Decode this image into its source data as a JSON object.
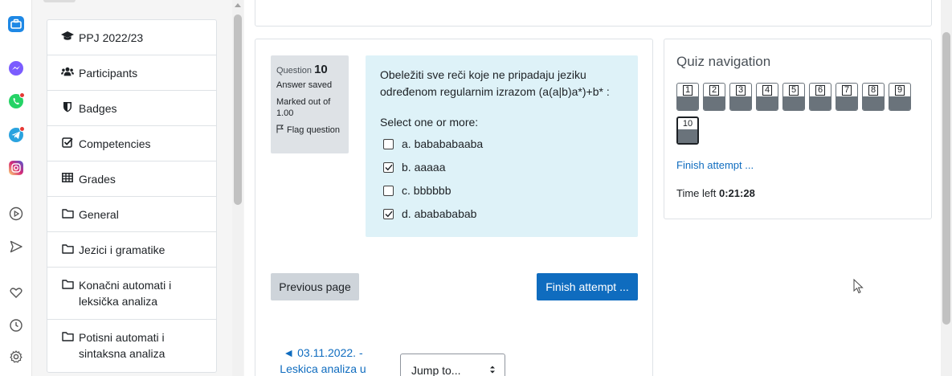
{
  "browser_sidebar": {
    "icons": [
      "briefcase-icon",
      "messenger-icon",
      "whatsapp-icon",
      "telegram-icon",
      "instagram-icon",
      "play-circle-icon",
      "send-icon",
      "heart-icon",
      "clock-icon",
      "settings-icon"
    ]
  },
  "course_index": {
    "items": [
      {
        "label": "PPJ 2022/23",
        "icon": "graduation-cap-icon"
      },
      {
        "label": "Participants",
        "icon": "users-icon"
      },
      {
        "label": "Badges",
        "icon": "shield-icon"
      },
      {
        "label": "Competencies",
        "icon": "checkbox-icon"
      },
      {
        "label": "Grades",
        "icon": "table-icon"
      },
      {
        "label": "General",
        "icon": "folder-icon"
      },
      {
        "label": "Jezici i gramatike",
        "icon": "folder-icon"
      },
      {
        "label": "Konačni automati i",
        "label2": "leksička analiza",
        "icon": "folder-icon"
      },
      {
        "label": "Potisni automati i",
        "label2": "sintaksna analiza",
        "icon": "folder-icon"
      }
    ]
  },
  "question": {
    "label": "Question",
    "number": "10",
    "state": "Answer saved",
    "grade": "Marked out of 1.00",
    "flag_label": "Flag question",
    "text": "Obeležiti sve reči koje ne pripadaju jeziku određenom regularnim izrazom (a(a|b)a*)+b* :",
    "prompt": "Select one or more:",
    "answers": [
      {
        "label": "a. babababaaba",
        "checked": false
      },
      {
        "label": "b. aaaaa",
        "checked": true
      },
      {
        "label": "c. bbbbbb",
        "checked": false
      },
      {
        "label": "d. ababababab",
        "checked": true
      }
    ]
  },
  "actions": {
    "previous_label": "Previous page",
    "finish_label": "Finish attempt ..."
  },
  "activity_nav": {
    "prev_line1": "◄ 03.11.2022. -",
    "prev_line2": "Leskica analiza u",
    "jump_label": "Jump to..."
  },
  "quiz_navigation": {
    "title": "Quiz navigation",
    "buttons": [
      "1",
      "2",
      "3",
      "4",
      "5",
      "6",
      "7",
      "8",
      "9",
      "10"
    ],
    "current": "10",
    "finish_link": "Finish attempt ...",
    "time_label": "Time left",
    "time_value": "0:21:28"
  },
  "colors": {
    "accent": "#0f6cbf",
    "question_bg": "#def2f8",
    "info_bg": "#dee2e6"
  }
}
